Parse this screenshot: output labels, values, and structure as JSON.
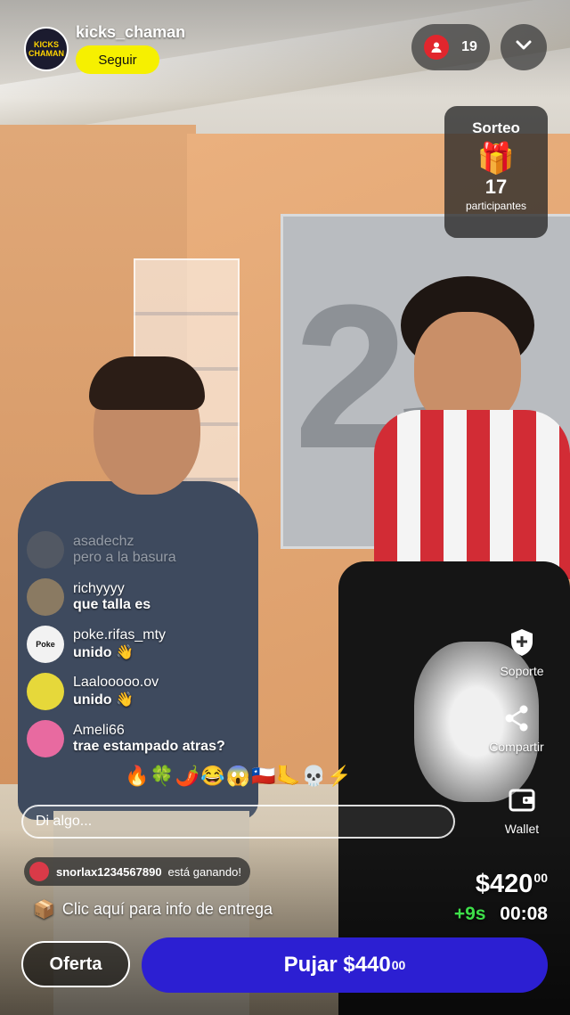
{
  "header": {
    "avatar_text": "KICKS CHAMAN",
    "username": "kicks_chaman",
    "follow_label": "Seguir",
    "viewer_count": "19"
  },
  "giveaway": {
    "title": "Sorteo",
    "count": "17",
    "label": "participantes"
  },
  "side_actions": [
    {
      "label": "Soporte",
      "icon": "shield-plus-icon"
    },
    {
      "label": "Compartir",
      "icon": "share-icon"
    },
    {
      "label": "Wallet",
      "icon": "wallet-icon"
    }
  ],
  "chat": [
    {
      "user": "asadechz",
      "message": "pero a la basura",
      "avatar_color": "#6b6b6b"
    },
    {
      "user": "richyyyy",
      "message": "que talla es",
      "avatar_color": "#8a7a62"
    },
    {
      "user": "poke.rifas_mty",
      "message": "unido 👋",
      "avatar_color": "#f2f2f2",
      "avatar_text": "Poke"
    },
    {
      "user": "Laalooooo.ov",
      "message": "unido 👋",
      "avatar_color": "#e6d83a"
    },
    {
      "user": "Ameli66",
      "message": "trae estampado atras?",
      "avatar_color": "#e86aa0"
    }
  ],
  "reactions": "🔥🍀🌶️😂😱🇨🇱🦶💀⚡",
  "comment_input": {
    "placeholder": "Di algo..."
  },
  "winning": {
    "user": "snorlax1234567890",
    "status": "está ganando!"
  },
  "delivery": {
    "text": "Clic aquí para info de entrega"
  },
  "auction": {
    "price_main": "$420",
    "price_cents": "00",
    "time_extension": "+9s",
    "timer": "00:08",
    "offer_label": "Oferta",
    "bid_label": "Pujar $440",
    "bid_cents": "00"
  },
  "colors": {
    "follow_button": "#f6f000",
    "bid_button": "#2c1fd2",
    "viewer_icon": "#e1262d",
    "time_extension": "#3ee04a"
  }
}
